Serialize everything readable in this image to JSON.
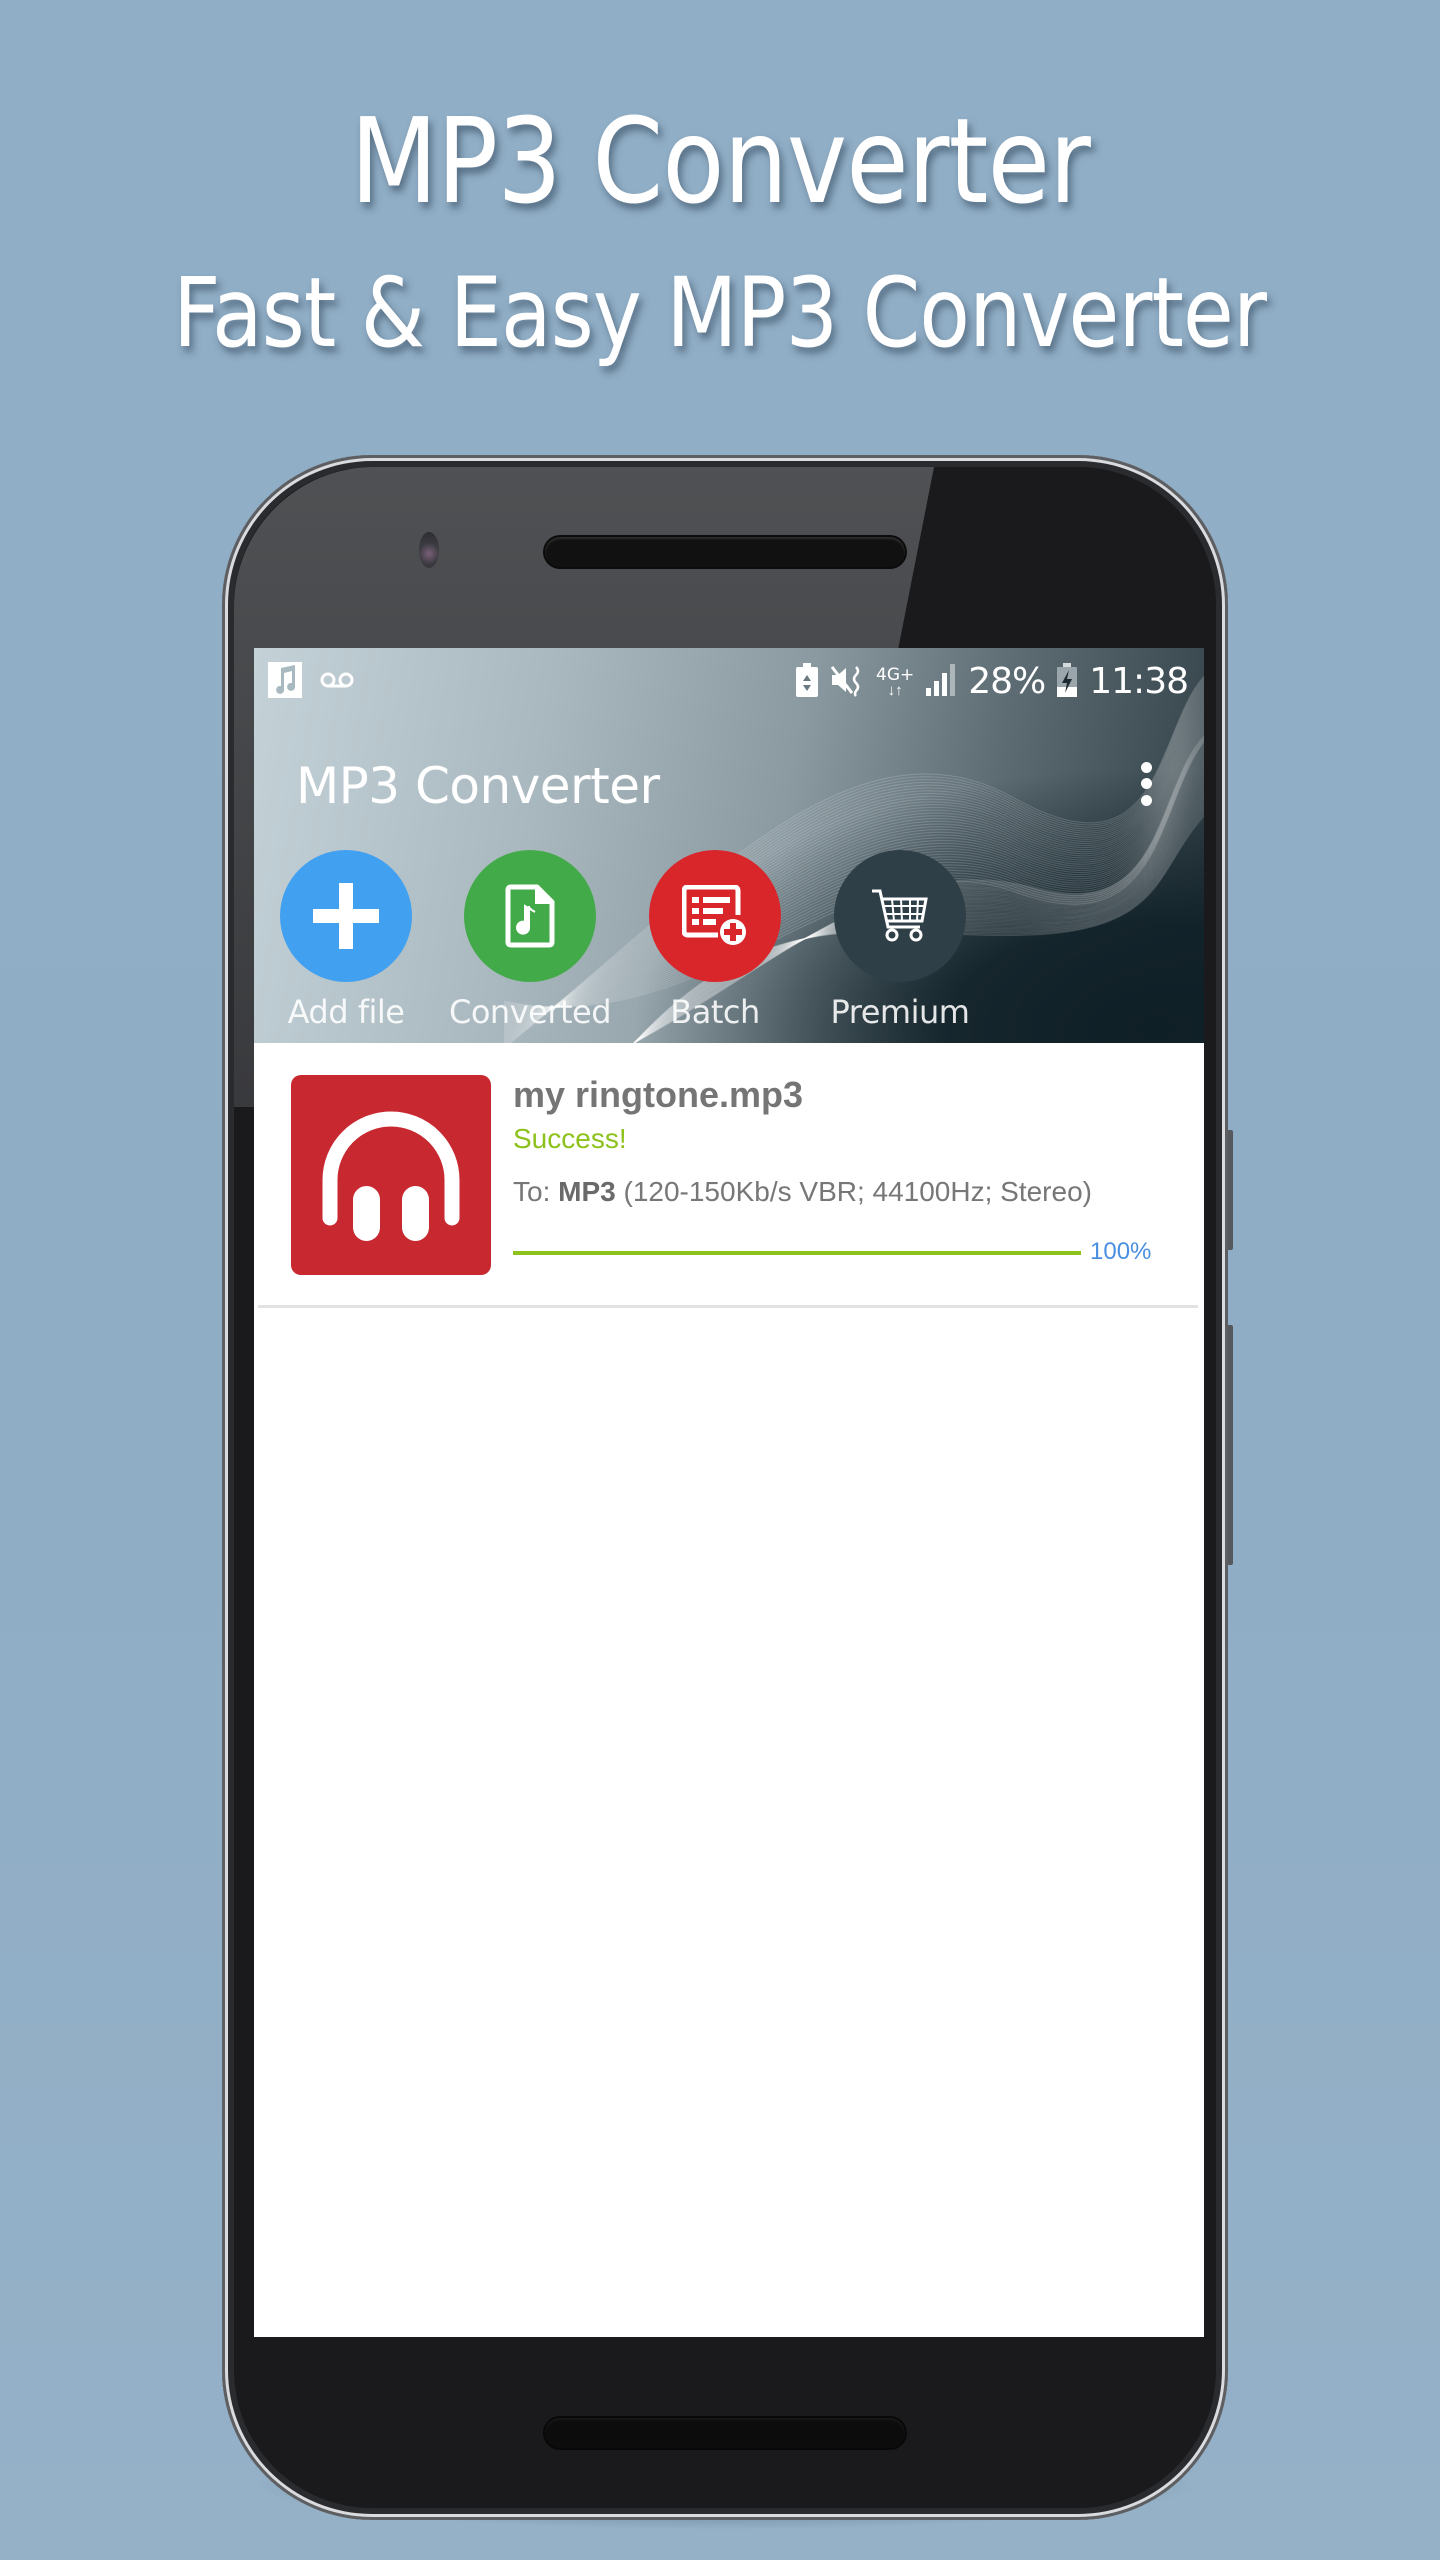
{
  "promo": {
    "headline": "MP3 Converter",
    "subheadline": "Fast & Easy MP3 Converter"
  },
  "status_bar": {
    "left_icons": [
      "music-notification-icon",
      "voicemail-icon"
    ],
    "right_icons": [
      "battery-saver-icon",
      "mute-vibrate-icon",
      "4g-plus-data-icon",
      "signal-icon"
    ],
    "network_label": "4G+",
    "battery_percent": "28%",
    "time": "11:38"
  },
  "app_bar": {
    "title": "MP3 Converter",
    "menu_icon": "more-vert-icon"
  },
  "actions": [
    {
      "label": "Add file",
      "icon": "plus-icon",
      "color": "#42a0f0"
    },
    {
      "label": "Converted",
      "icon": "music-file-icon",
      "color": "#43aa4a"
    },
    {
      "label": "Batch",
      "icon": "batch-list-add-icon",
      "color": "#d9262b"
    },
    {
      "label": "Premium",
      "icon": "cart-icon",
      "color": "#2f3f48"
    }
  ],
  "files": [
    {
      "name": "my ringtone.mp3",
      "status": "Success!",
      "format_prefix": "To: ",
      "format_name": "MP3",
      "format_details": " (120-150Kb/s VBR; 44100Hz; Stereo)",
      "progress": 1.0,
      "progress_label": "100%",
      "thumbnail_icon": "headphones-icon"
    }
  ],
  "colors": {
    "success": "#8cc21b",
    "progress_text": "#4a8fe0",
    "thumbnail_bg": "#c8282f"
  }
}
